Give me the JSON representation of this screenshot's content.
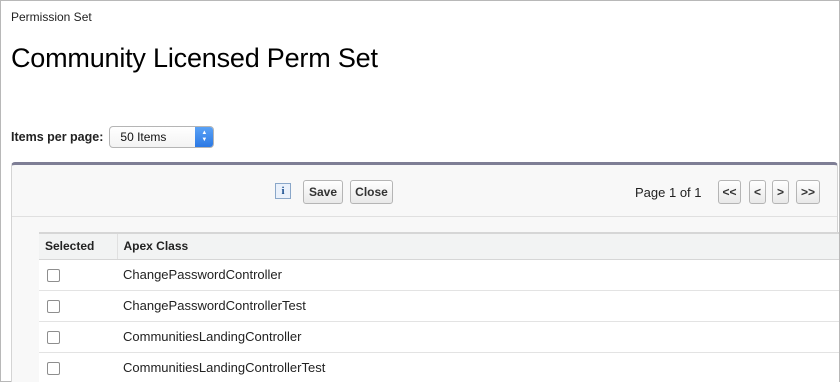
{
  "breadcrumb": "Permission Set",
  "title": "Community Licensed Perm Set",
  "items_per_page": {
    "label": "Items per page:",
    "selected": "50 Items"
  },
  "toolbar": {
    "info_icon_glyph": "i",
    "save_label": "Save",
    "close_label": "Close"
  },
  "pagination": {
    "page_info": "Page 1 of 1",
    "first": "<<",
    "prev": "<",
    "next": ">",
    "last": ">>"
  },
  "table": {
    "headers": [
      "Selected",
      "Apex Class"
    ],
    "rows": [
      {
        "apex_class": "ChangePasswordController",
        "selected": false
      },
      {
        "apex_class": "ChangePasswordControllerTest",
        "selected": false
      },
      {
        "apex_class": "CommunitiesLandingController",
        "selected": false
      },
      {
        "apex_class": "CommunitiesLandingControllerTest",
        "selected": false
      }
    ]
  },
  "colors": {
    "panel_top_border": "#7e7e95",
    "select_arrow": "#2b78e4"
  },
  "icons": {
    "info": "info-icon",
    "select_arrows": "chevron-updown-icon"
  }
}
